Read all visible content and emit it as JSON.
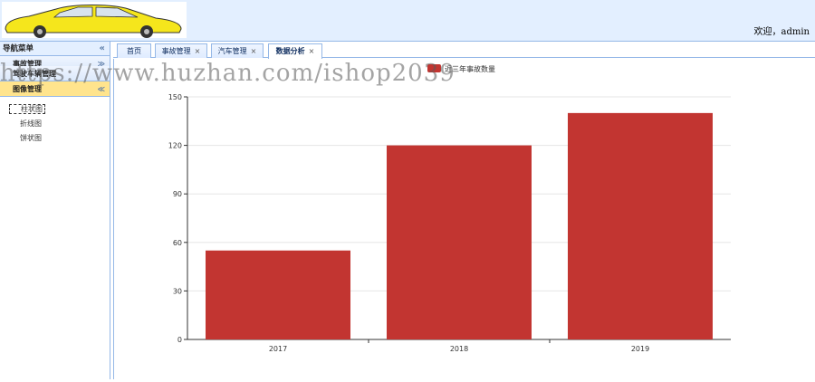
{
  "header": {
    "welcome": "欢迎，admin"
  },
  "sidebar": {
    "title": "导航菜单",
    "collapse_glyph": "«",
    "sections": [
      {
        "label": "事故管理",
        "chev": "≫"
      },
      {
        "label": "驾驶车辆管理",
        "chev": ""
      },
      {
        "label": "图像管理",
        "chev": "≪"
      }
    ],
    "tree": [
      "柱状图",
      "折线图",
      "饼状图"
    ]
  },
  "tabs": [
    {
      "label": "首页",
      "closable": false
    },
    {
      "label": "事故管理",
      "closable": true
    },
    {
      "label": "汽车管理",
      "closable": true
    },
    {
      "label": "数据分析",
      "closable": true
    }
  ],
  "watermark": "https://www.huzhan.com/ishop2039",
  "colors": {
    "bar": "#c23531",
    "header_bg": "#e3efff",
    "border": "#95b8e7",
    "active_section": "#ffe48d",
    "car_body": "#f5e61c"
  },
  "chart_data": {
    "type": "bar",
    "categories": [
      "2017",
      "2018",
      "2019"
    ],
    "series": [
      {
        "name": "近三年事故数量",
        "values": [
          55,
          120,
          140
        ]
      }
    ],
    "ylim": [
      0,
      150
    ],
    "yticks": [
      "0",
      "30",
      "60",
      "90",
      "120",
      "150"
    ],
    "grid": true,
    "legend": "top"
  }
}
